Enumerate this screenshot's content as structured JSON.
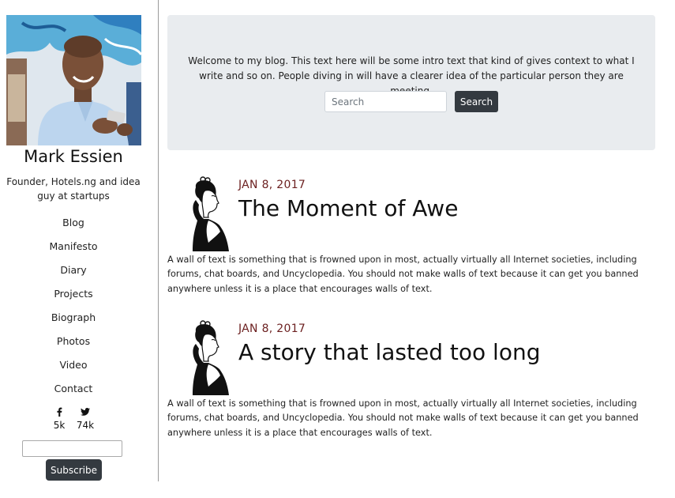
{
  "profile": {
    "name": "Mark Essien",
    "tagline": "Founder, Hotels.ng and idea guy at startups"
  },
  "nav": {
    "items": [
      {
        "label": "Blog"
      },
      {
        "label": "Manifesto"
      },
      {
        "label": "Diary"
      },
      {
        "label": "Projects"
      },
      {
        "label": "Biograph"
      },
      {
        "label": "Photos"
      },
      {
        "label": "Video"
      },
      {
        "label": "Contact"
      }
    ]
  },
  "social": {
    "facebook": {
      "icon": "facebook-icon",
      "count": "5k"
    },
    "twitter": {
      "icon": "twitter-icon",
      "count": "74k"
    }
  },
  "subscribe": {
    "button_label": "Subscribe",
    "input_value": ""
  },
  "intro": {
    "text": "Welcome to my blog. This text here will be some intro text that kind of gives context to what I write and so on. People diving in will have a clearer idea of the particular person they are meeting.",
    "search_placeholder": "Search",
    "search_button": "Search"
  },
  "posts": [
    {
      "date": "JAN 8, 2017",
      "title": "The Moment of Awe",
      "body": "A wall of text is something that is frowned upon in most, actually virtually all Internet societies, including forums, chat boards, and Uncyclopedia. You should not make walls of text because it can get you banned anywhere unless it is a place that encourages walls of text."
    },
    {
      "date": "JAN 8, 2017",
      "title": "A story that lasted too long",
      "body": "A wall of text is something that is frowned upon in most, actually virtually all Internet societies, including forums, chat boards, and Uncyclopedia. You should not make walls of text because it can get you banned anywhere unless it is a place that encourages walls of text."
    }
  ],
  "colors": {
    "jumbotron_bg": "#e9ecef",
    "dark_button": "#343a40",
    "date_color": "#6b1f1f"
  }
}
